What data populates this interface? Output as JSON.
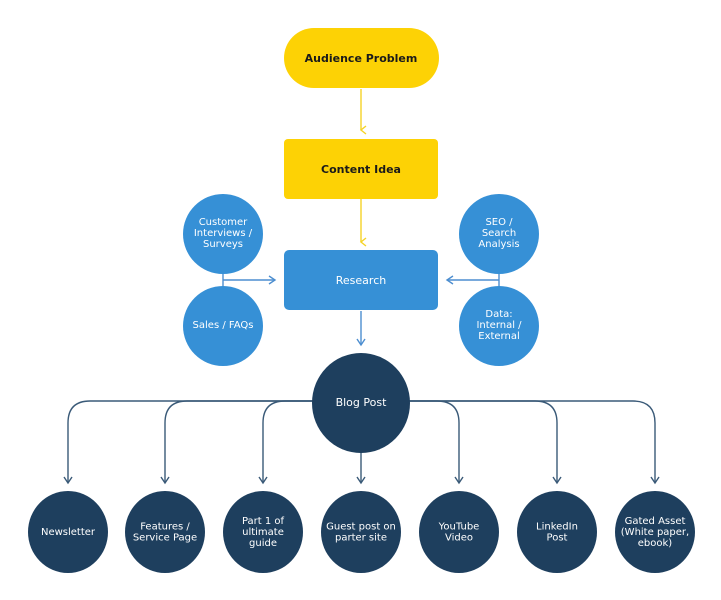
{
  "colors": {
    "yellow": "#FDD205",
    "blue": "#3690D6",
    "navy": "#1E3F5E",
    "yellow_line": "#F5D327",
    "blue_line": "#4D8ED0",
    "navy_line": "#3A5A78"
  },
  "nodes": {
    "audience_problem": [
      "Audience Problem"
    ],
    "content_idea": [
      "Content Idea"
    ],
    "research": [
      "Research"
    ],
    "customer": [
      "Customer",
      "Interviews /",
      "Surveys"
    ],
    "sales": [
      "Sales / FAQs"
    ],
    "seo": [
      "SEO /",
      "Search",
      "Analysis"
    ],
    "data": [
      "Data:",
      "Internal /",
      "External"
    ],
    "blog_post": [
      "Blog Post"
    ]
  },
  "outputs": [
    [
      "Newsletter"
    ],
    [
      "Features /",
      "Service Page"
    ],
    [
      "Part 1 of",
      "ultimate",
      "guide"
    ],
    [
      "Guest post on",
      "parter site"
    ],
    [
      "YouTube",
      "Video"
    ],
    [
      "LinkedIn",
      "Post"
    ],
    [
      "Gated Asset",
      "(White paper,",
      "ebook)"
    ]
  ]
}
